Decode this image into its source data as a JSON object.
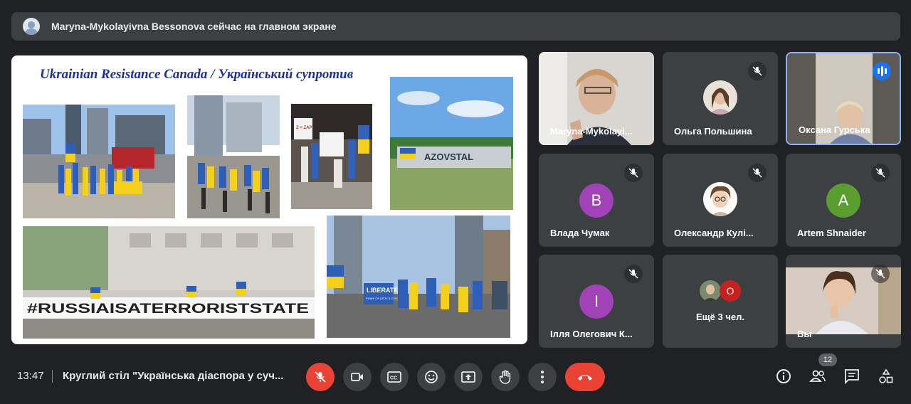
{
  "banner": {
    "text": "Maryna-Mykolayivna Bessonova сейчас на главном экране"
  },
  "presentation": {
    "title": "Ukrainian Resistance Canada / Український супротив",
    "sign_azovstal": "AZOVSTAL",
    "sign_hashtag": "#RUSSIAISATERRORISTSTATE",
    "sign_liberate": "LIBERATE",
    "sign_liberate_sub": "POWS OF AZOV & CIVILIANS",
    "sign_zap": "Z = ZAP"
  },
  "participants": [
    {
      "name": "Maryna-Mykolayi...",
      "muted": false
    },
    {
      "name": "Ольга Польшина",
      "muted": true
    },
    {
      "name": "Оксана Гурська",
      "muted": false,
      "speaking": true
    },
    {
      "name": "Влада Чумак",
      "initial": "B",
      "color": "#a142b8",
      "muted": true
    },
    {
      "name": "Олександр Кулі...",
      "muted": true
    },
    {
      "name": "Artem Shnaider",
      "initial": "A",
      "color": "#5a9e2f",
      "muted": true
    },
    {
      "name": "Ілля Олегович К...",
      "initial": "I",
      "color": "#a142b8",
      "muted": true
    },
    {
      "name": "Ещё 3 чел.",
      "extra_initial": "O",
      "extra_color": "#c5221f"
    },
    {
      "name": "Вы",
      "muted": true
    }
  ],
  "controls": {
    "time": "13:47",
    "meeting_title": "Круглий стіл \"Українська діаспора у суч...",
    "participant_count": "12"
  },
  "icons": [
    "mic-off-icon",
    "camera-icon",
    "captions-icon",
    "emoji-icon",
    "present-icon",
    "raise-hand-icon",
    "more-icon",
    "hangup-icon",
    "info-icon",
    "people-icon",
    "chat-icon",
    "activities-icon"
  ],
  "colors": {
    "background": "#202124",
    "tile": "#3c4043",
    "accent": "#8ab4f8",
    "danger": "#ea4335",
    "speaking": "#1a73e8"
  }
}
